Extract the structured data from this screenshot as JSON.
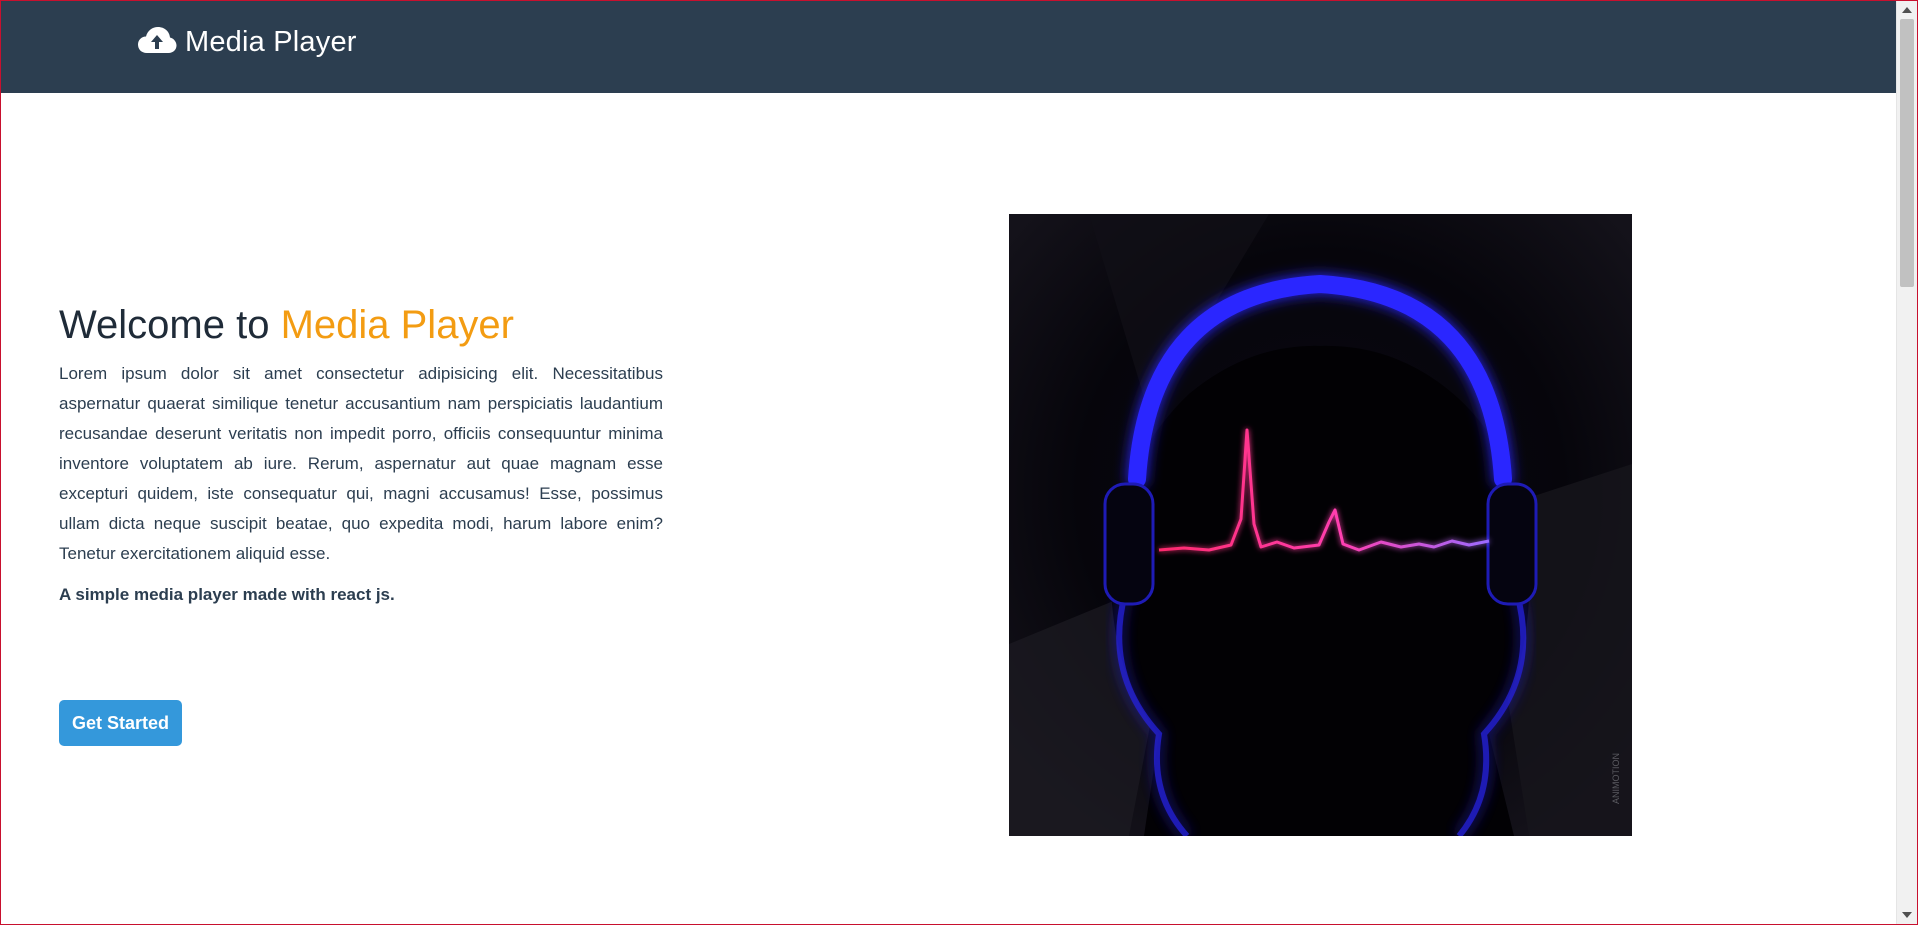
{
  "navbar": {
    "brand_title": "Media Player",
    "brand_icon": "cloud-upload-icon",
    "background": "#2c3e50"
  },
  "hero": {
    "title_prefix": "Welcome to ",
    "title_accent": "Media Player",
    "accent_color": "#f39c12",
    "description": "Lorem ipsum dolor sit amet consectetur adipisicing elit. Necessitatibus aspernatur quaerat similique tenetur accusantium nam perspiciatis laudantium recusandae deserunt veritatis non impedit porro, officiis consequuntur minima inventore voluptatem ab iure. Rerum, aspernatur aut quae magnam esse excepturi quidem, iste consequatur qui, magni accusamus! Esse, possimus ullam dicta neque suscipit beatae, quo expedita modi, harum labore enim? Tenetur exercitationem aliquid esse.",
    "tagline": "A simple media player made with react js.",
    "cta_label": "Get Started",
    "cta_color": "#3498db"
  },
  "illustration": {
    "subject": "headphones-heartbeat-illustration",
    "watermark": "ANIMOTION"
  },
  "scrollbar": {
    "up_icon": "scroll-up-arrow-icon",
    "down_icon": "scroll-down-arrow-icon"
  }
}
